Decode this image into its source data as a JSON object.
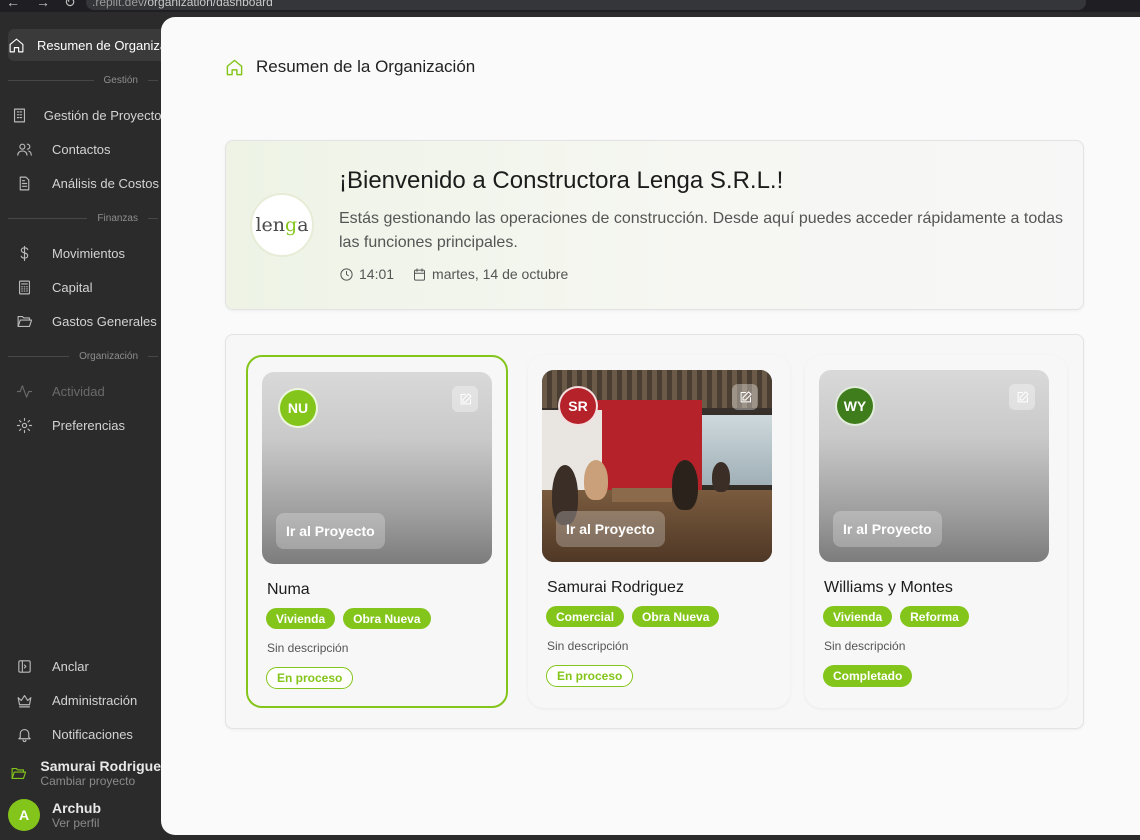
{
  "browser": {
    "url_host": ".replit.dev",
    "url_path": "/organization/dashboard"
  },
  "sidebar": {
    "active_item": "Resumen de Organización",
    "sections": {
      "gestion": "Gestión",
      "finanzas": "Finanzas",
      "organizacion": "Organización"
    },
    "items": {
      "resumen": "Resumen de Organización",
      "proyectos": "Gestión de Proyectos",
      "contactos": "Contactos",
      "costos": "Análisis de Costos",
      "movimientos": "Movimientos",
      "capital": "Capital",
      "gastos": "Gastos Generales",
      "actividad": "Actividad",
      "preferencias": "Preferencias"
    },
    "bottom": {
      "anclar": "Anclar",
      "administracion": "Administración",
      "notificaciones": "Notificaciones",
      "project_name": "Samurai Rodriguez",
      "project_sub": "Cambiar proyecto",
      "user_name": "Archub",
      "user_sub": "Ver perfil",
      "user_initial": "A"
    }
  },
  "header": {
    "title": "Resumen de la Organización"
  },
  "welcome": {
    "logo_text_a": "len",
    "logo_text_b": "g",
    "logo_text_c": "a",
    "heading": "¡Bienvenido a Constructora Lenga S.R.L.!",
    "description": "Estás gestionando las operaciones de construcción. Desde aquí puedes acceder rápidamente a todas las funciones principales.",
    "time": "14:01",
    "date": "martes, 14 de octubre"
  },
  "projects": [
    {
      "initials": "NU",
      "initials_color": "#84c51b",
      "button": "Ir al Proyecto",
      "name": "Numa",
      "tags": [
        "Vivienda",
        "Obra Nueva"
      ],
      "description": "Sin descripción",
      "status": "En proceso",
      "status_style": "outline",
      "selected": true
    },
    {
      "initials": "SR",
      "initials_color": "#b5222a",
      "button": "Ir al Proyecto",
      "name": "Samurai Rodriguez",
      "tags": [
        "Comercial",
        "Obra Nueva"
      ],
      "description": "Sin descripción",
      "status": "En proceso",
      "status_style": "outline",
      "selected": false
    },
    {
      "initials": "WY",
      "initials_color": "#3f7d1c",
      "button": "Ir al Proyecto",
      "name": "Williams y Montes",
      "tags": [
        "Vivienda",
        "Reforma"
      ],
      "description": "Sin descripción",
      "status": "Completado",
      "status_style": "filled",
      "selected": false
    }
  ],
  "colors": {
    "accent": "#84c51b",
    "sidebar_bg": "#2b2b2b",
    "panel_bg": "#fafafa"
  }
}
